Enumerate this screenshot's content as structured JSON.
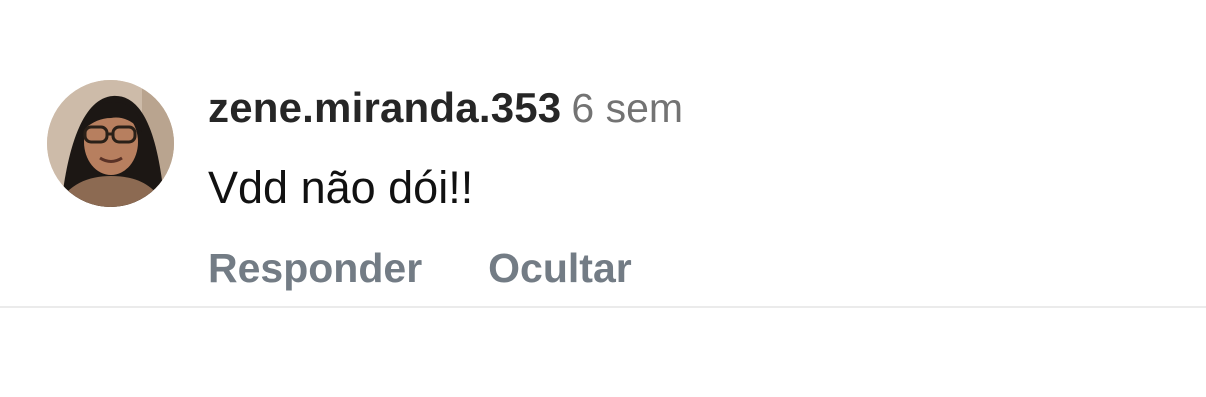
{
  "comment": {
    "username": "zene.miranda.353",
    "timestamp": "6 sem",
    "text": "Vdd não dói!!",
    "avatar_icon": "profile-photo",
    "actions": {
      "reply_label": "Responder",
      "hide_label": "Ocultar"
    }
  },
  "colors": {
    "username": "#262626",
    "timestamp": "#737373",
    "action": "#737c85",
    "divider": "#ebebeb"
  }
}
